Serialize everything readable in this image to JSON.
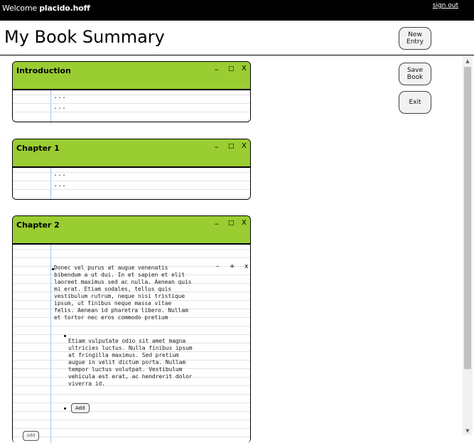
{
  "topbar": {
    "welcome_prefix": "Welcome",
    "username": "placido.hoff",
    "signout_label": "sign out"
  },
  "header": {
    "title": "My Book Summary"
  },
  "actions": {
    "new_entry": "New\nEntry",
    "save_book": "Save\nBook",
    "exit": "Exit"
  },
  "panel_controls": {
    "minimize": "–",
    "maximize": "□",
    "close": "X"
  },
  "chapters": [
    {
      "title": "Introduction",
      "lines": [
        "...",
        "..."
      ]
    },
    {
      "title": "Chapter 1",
      "lines": [
        "...",
        "..."
      ]
    },
    {
      "title": "Chapter 2",
      "entries": [
        {
          "text": "Donec vel purus at augue venenatis\nbibendum a ut dui. In et sapien et elit\nlaoreet maximus sed ac nulla. Aenean quis\nmi erat. Etiam sodales, tellus quis\nvestibulum rutrum, neque nisi tristique\nipsum, ut finibus neque massa vitae\nfelis. Aenean id pharetra libero. Nullam\net tortor nec eros commodo pretium",
          "controls": {
            "minus": "–",
            "plus": "+",
            "close": "x"
          }
        },
        {
          "text": "Etiam vulputate odio sit amet magna\nultricies luctus. Nulla finibus ipsum\nat fringilla maximus. Sed pretium\naugue in velit dictum porta. Nullam\ntempor luctus volutpat. Vestibulum\nvehicula est erat, ac hendrerit dolor\nviverra id."
        }
      ],
      "add_label": "Add",
      "bottom_add_label": "add"
    }
  ]
}
